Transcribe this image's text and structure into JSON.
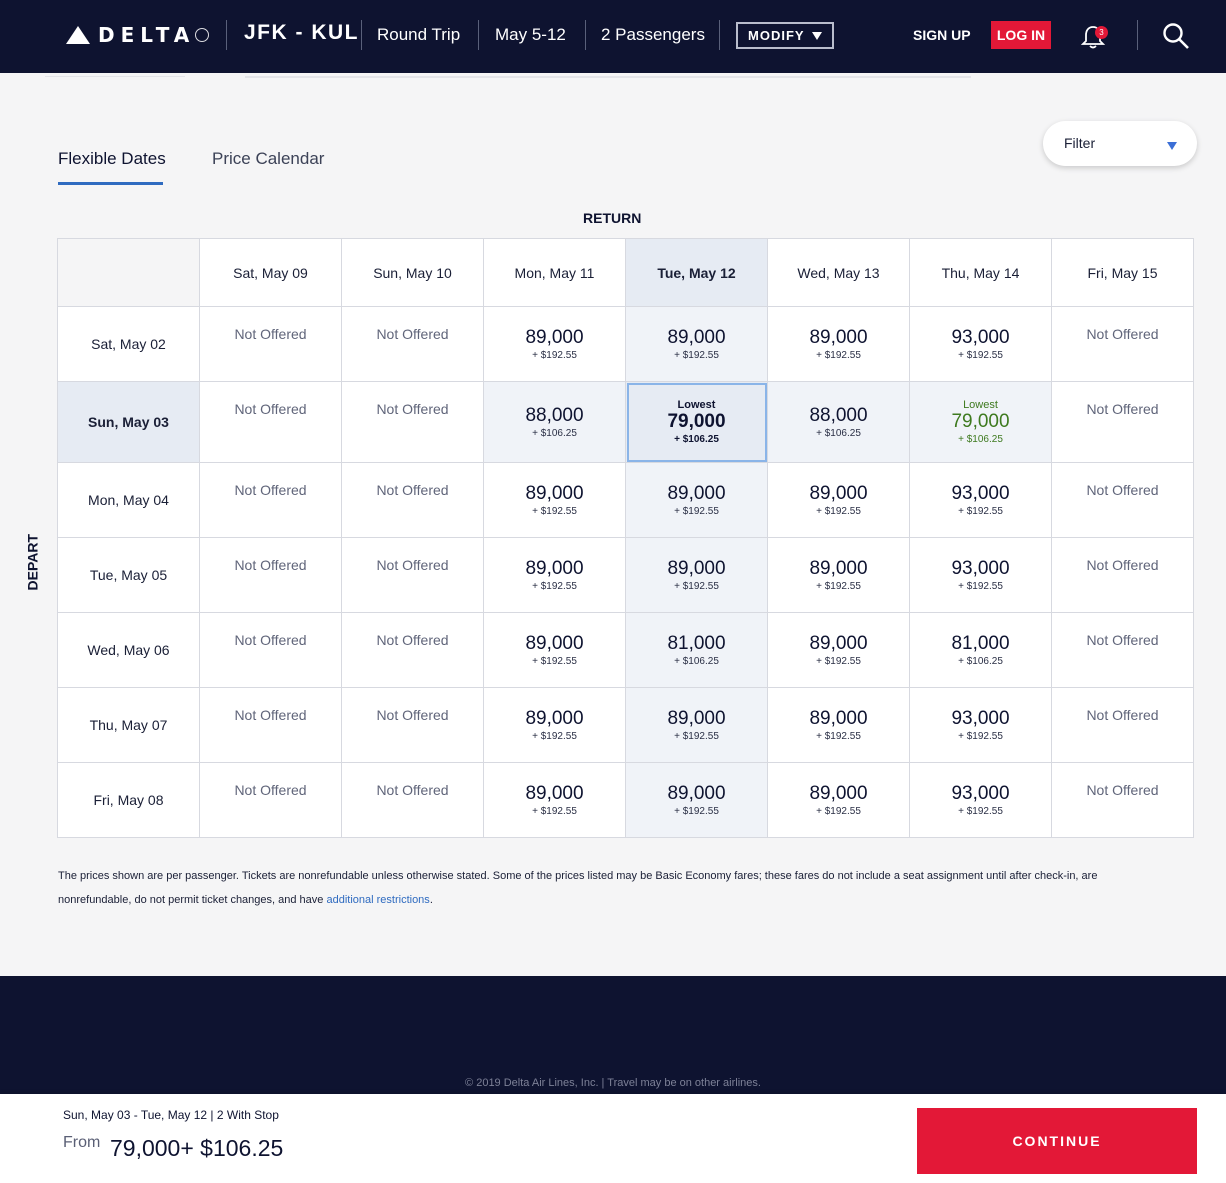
{
  "header": {
    "logo_text": "DELTA",
    "route": "JFK - KUL",
    "trip_type": "Round Trip",
    "dates": "May 5-12",
    "passengers": "2 Passengers",
    "modify_label": "MODIFY",
    "signup_label": "SIGN UP",
    "login_label": "LOG IN",
    "notification_count": "3"
  },
  "tabs": [
    {
      "label": "Flexible Dates",
      "active": true
    },
    {
      "label": "Price Calendar",
      "active": false
    }
  ],
  "filter_label": "Filter",
  "return_label": "RETURN",
  "depart_label": "DEPART",
  "columns": [
    "Sat, May 09",
    "Sun, May 10",
    "Mon, May 11",
    "Tue, May 12",
    "Wed, May 13",
    "Thu, May 14",
    "Fri, May 15"
  ],
  "rows": [
    {
      "label": "Sat, May 02",
      "cells": [
        {
          "offered": false,
          "text": "Not Offered"
        },
        {
          "offered": false,
          "text": "Not Offered"
        },
        {
          "price": "89,000",
          "tax": "+ $192.55"
        },
        {
          "price": "89,000",
          "tax": "+ $192.55"
        },
        {
          "price": "89,000",
          "tax": "+ $192.55"
        },
        {
          "price": "93,000",
          "tax": "+ $192.55"
        },
        {
          "offered": false,
          "text": "Not Offered"
        }
      ]
    },
    {
      "label": "Sun, May 03",
      "cells": [
        {
          "offered": false,
          "text": "Not Offered"
        },
        {
          "offered": false,
          "text": "Not Offered"
        },
        {
          "price": "88,000",
          "tax": "+ $106.25"
        },
        {
          "price": "79,000",
          "tax": "+ $106.25",
          "badge": "Lowest"
        },
        {
          "price": "88,000",
          "tax": "+ $106.25"
        },
        {
          "price": "79,000",
          "tax": "+ $106.25",
          "badge": "Lowest"
        },
        {
          "offered": false,
          "text": "Not Offered"
        }
      ]
    },
    {
      "label": "Mon, May 04",
      "cells": [
        {
          "offered": false,
          "text": "Not Offered"
        },
        {
          "offered": false,
          "text": "Not Offered"
        },
        {
          "price": "89,000",
          "tax": "+ $192.55"
        },
        {
          "price": "89,000",
          "tax": "+ $192.55"
        },
        {
          "price": "89,000",
          "tax": "+ $192.55"
        },
        {
          "price": "93,000",
          "tax": "+ $192.55"
        },
        {
          "offered": false,
          "text": "Not Offered"
        }
      ]
    },
    {
      "label": "Tue, May 05",
      "cells": [
        {
          "offered": false,
          "text": "Not Offered"
        },
        {
          "offered": false,
          "text": "Not Offered"
        },
        {
          "price": "89,000",
          "tax": "+ $192.55"
        },
        {
          "price": "89,000",
          "tax": "+ $192.55"
        },
        {
          "price": "89,000",
          "tax": "+ $192.55"
        },
        {
          "price": "93,000",
          "tax": "+ $192.55"
        },
        {
          "offered": false,
          "text": "Not Offered"
        }
      ]
    },
    {
      "label": "Wed, May 06",
      "cells": [
        {
          "offered": false,
          "text": "Not Offered"
        },
        {
          "offered": false,
          "text": "Not Offered"
        },
        {
          "price": "89,000",
          "tax": "+ $192.55"
        },
        {
          "price": "81,000",
          "tax": "+ $106.25"
        },
        {
          "price": "89,000",
          "tax": "+ $192.55"
        },
        {
          "price": "81,000",
          "tax": "+ $106.25"
        },
        {
          "offered": false,
          "text": "Not Offered"
        }
      ]
    },
    {
      "label": "Thu, May 07",
      "cells": [
        {
          "offered": false,
          "text": "Not Offered"
        },
        {
          "offered": false,
          "text": "Not Offered"
        },
        {
          "price": "89,000",
          "tax": "+ $192.55"
        },
        {
          "price": "89,000",
          "tax": "+ $192.55"
        },
        {
          "price": "89,000",
          "tax": "+ $192.55"
        },
        {
          "price": "93,000",
          "tax": "+ $192.55"
        },
        {
          "offered": false,
          "text": "Not Offered"
        }
      ]
    },
    {
      "label": "Fri, May 08",
      "cells": [
        {
          "offered": false,
          "text": "Not Offered"
        },
        {
          "offered": false,
          "text": "Not Offered"
        },
        {
          "price": "89,000",
          "tax": "+ $192.55"
        },
        {
          "price": "89,000",
          "tax": "+ $192.55"
        },
        {
          "price": "89,000",
          "tax": "+ $192.55"
        },
        {
          "price": "93,000",
          "tax": "+ $192.55"
        },
        {
          "offered": false,
          "text": "Not Offered"
        }
      ]
    }
  ],
  "selection": {
    "row": 1,
    "col": 3
  },
  "highlight": {
    "row": 1,
    "col": 3
  },
  "green_cell": {
    "row": 1,
    "col": 5
  },
  "disclaimer": {
    "text": "The prices shown are per passenger. Tickets are nonrefundable unless otherwise stated. Some of the prices listed may be Basic Economy fares; these fares do not include a seat assignment until after check-in, are nonrefundable, do not permit ticket changes, and have ",
    "link": "additional restrictions",
    "end": "."
  },
  "footer": {
    "copyright": "© 2019 Delta Air Lines, Inc.   |   Travel may be on other airlines."
  },
  "summary": {
    "line": "Sun, May 03  - Tue, May 12   |   2 With Stop",
    "from_label": "From",
    "price": "79,000+ $106.25",
    "continue_label": "CONTINUE"
  },
  "colors": {
    "navy": "#0e1330",
    "red": "#e31837",
    "accent_blue": "#2f6bc0",
    "lowest_green": "#3e7a1f"
  }
}
